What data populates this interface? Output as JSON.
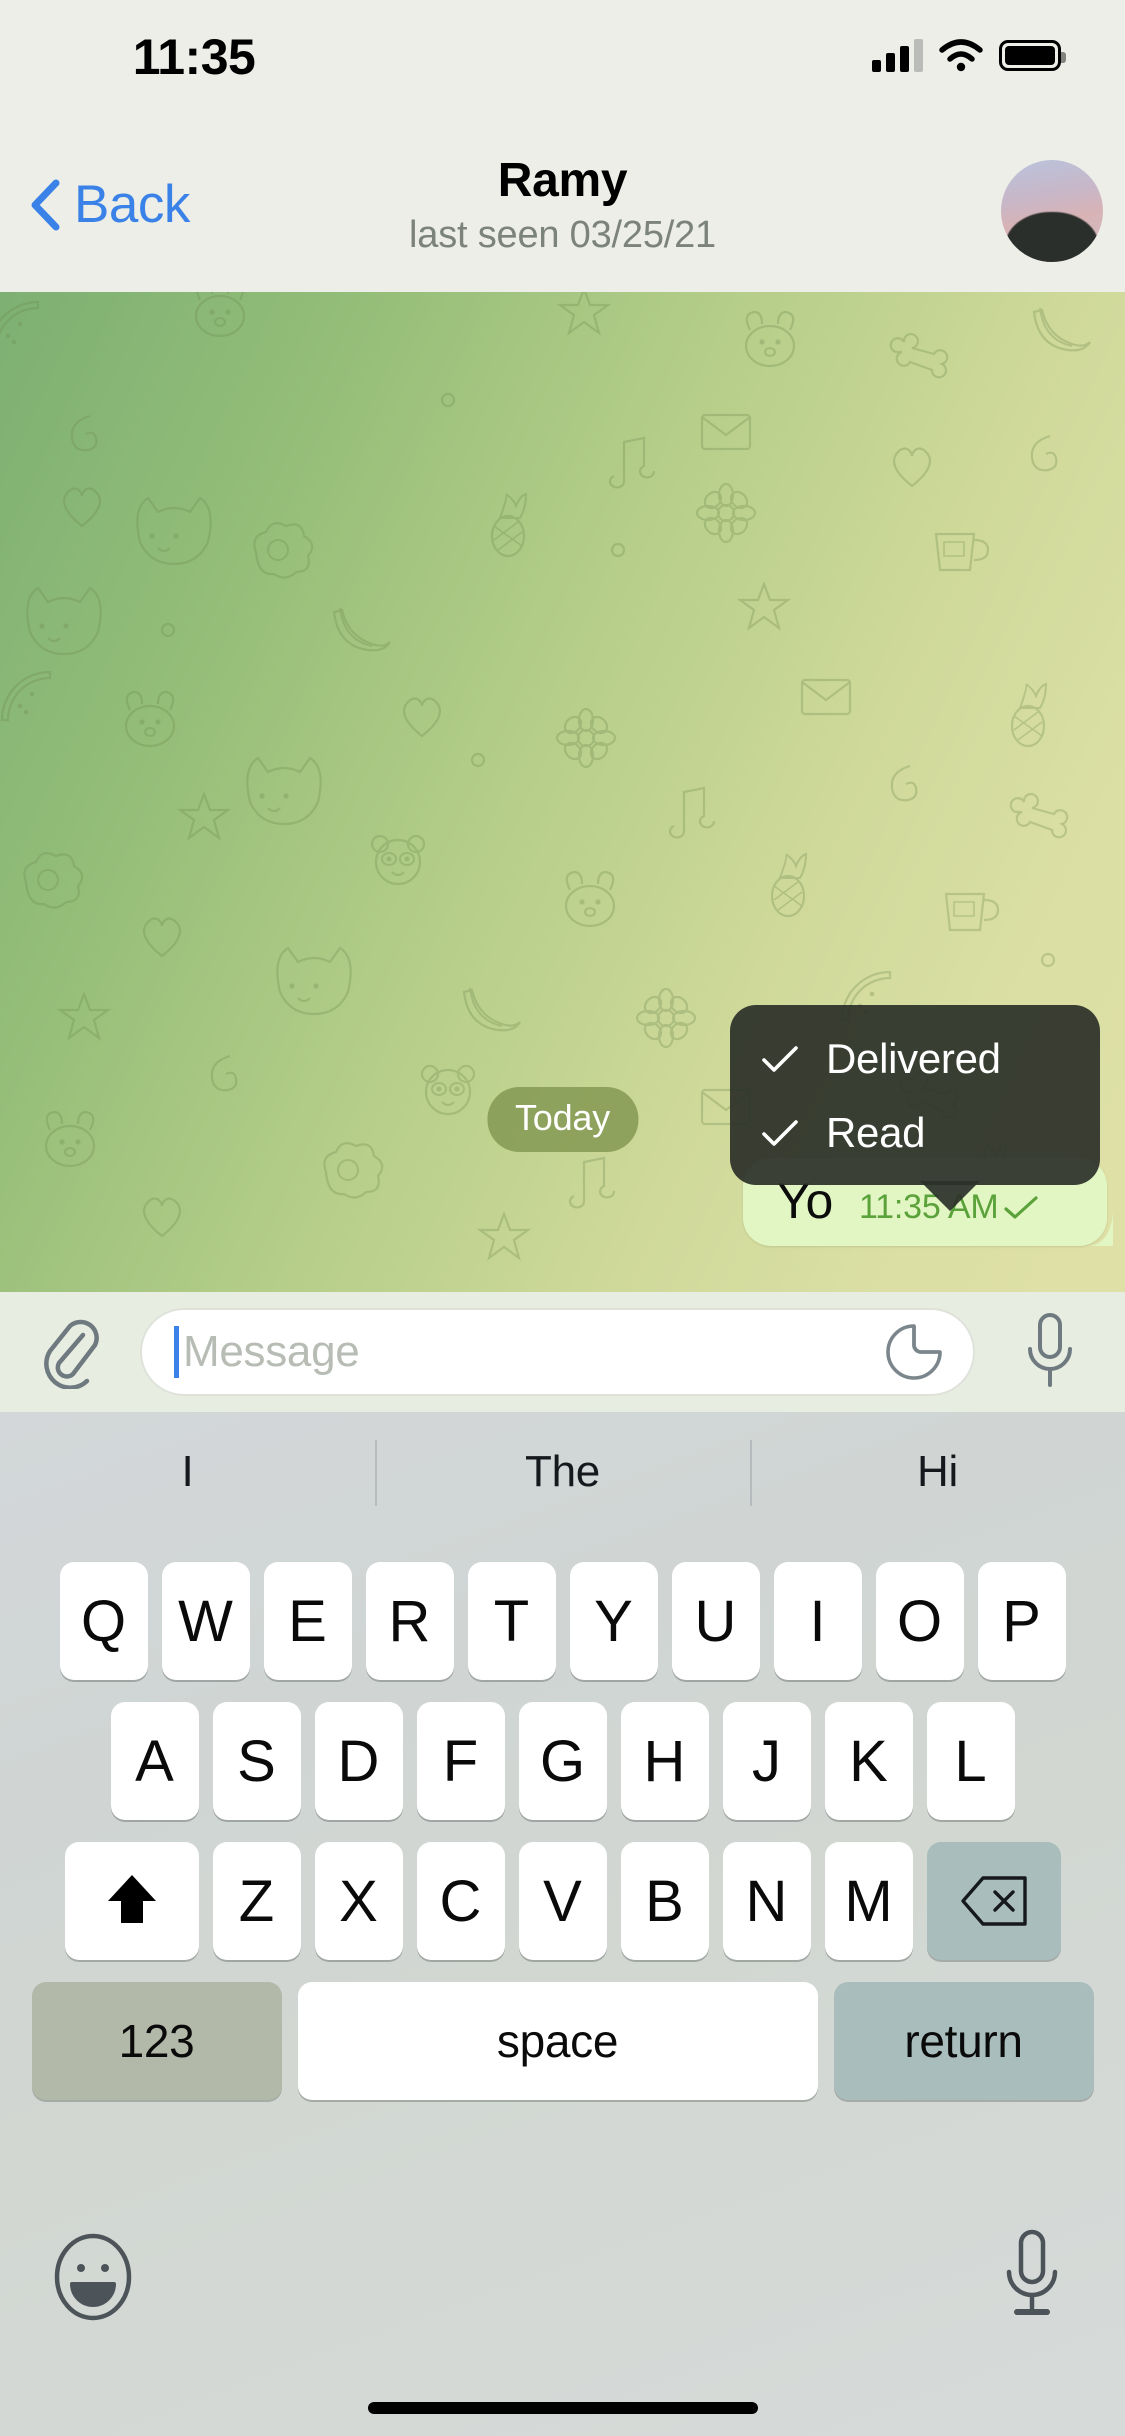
{
  "status_bar": {
    "time": "11:35",
    "signal_icon": "cellular-signal-icon",
    "wifi_icon": "wifi-icon",
    "battery_icon": "battery-full-icon"
  },
  "nav_bar": {
    "back_label": "Back",
    "back_icon": "chevron-left-icon",
    "title": "Ramy",
    "subtitle": "last seen 03/25/21",
    "avatar_name": "contact-avatar",
    "accent_color": "#3b82e8"
  },
  "chat": {
    "date_badge": "Today",
    "messages": [
      {
        "text": "Yo",
        "time": "11:35 AM",
        "outgoing": true,
        "status_icon": "single-check-icon",
        "bubble_color": "#e2f6c4",
        "meta_color": "#5ba23b"
      }
    ],
    "wallpaper": "telegram-doodle-pattern-green"
  },
  "status_tooltip": {
    "rows": [
      {
        "icon": "check-icon",
        "label": "Delivered"
      },
      {
        "icon": "check-icon",
        "label": "Read"
      }
    ],
    "background_color": "#2b3028"
  },
  "input_bar": {
    "attach_icon": "paperclip-icon",
    "placeholder": "Message",
    "value": "",
    "sticker_icon": "sticker-icon",
    "mic_icon": "microphone-icon",
    "caret_color": "#3b82e8"
  },
  "keyboard": {
    "suggestions": [
      "I",
      "The",
      "Hi"
    ],
    "row1": [
      "Q",
      "W",
      "E",
      "R",
      "T",
      "Y",
      "U",
      "I",
      "O",
      "P"
    ],
    "row2": [
      "A",
      "S",
      "D",
      "F",
      "G",
      "H",
      "J",
      "K",
      "L"
    ],
    "row3": [
      "Z",
      "X",
      "C",
      "V",
      "B",
      "N",
      "M"
    ],
    "shift_icon": "shift-arrow-icon",
    "backspace_icon": "backspace-icon",
    "numbers_key": "123",
    "space_key": "space",
    "return_key": "return",
    "emoji_icon": "emoji-smiley-icon",
    "dictation_icon": "microphone-icon"
  },
  "home_indicator": "home-indicator"
}
